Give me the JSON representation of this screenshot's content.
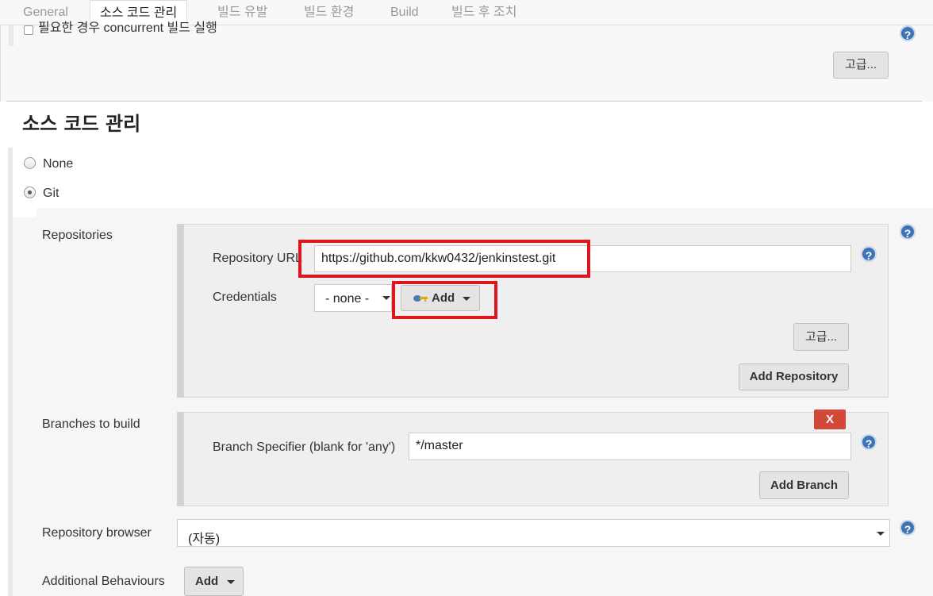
{
  "tabs": [
    "General",
    "소스 코드 관리",
    "빌드 유발",
    "빌드 환경",
    "Build",
    "빌드 후 조치"
  ],
  "top": {
    "concurrent_label": "필요한 경우 concurrent 빌드 실행",
    "advanced_label": "고급..."
  },
  "scm": {
    "title": "소스 코드 관리",
    "option_none": "None",
    "option_git": "Git",
    "repositories_label": "Repositories",
    "repo_url_label": "Repository URL",
    "repo_url_value": "https://github.com/kkw0432/jenkinstest.git",
    "credentials_label": "Credentials",
    "credentials_value": "- none -",
    "add_label": "Add",
    "advanced_label": "고급...",
    "add_repository_label": "Add Repository",
    "branches_label": "Branches to build",
    "delete_label": "X",
    "branch_spec_label": "Branch Specifier (blank for 'any')",
    "branch_spec_value": "*/master",
    "add_branch_label": "Add Branch",
    "repo_browser_label": "Repository browser",
    "repo_browser_value": "(자동)",
    "additional_label": "Additional Behaviours",
    "additional_add_label": "Add"
  },
  "help_glyph": "?",
  "colors": {
    "highlight": "#e0141e",
    "help": "#3e74b3",
    "danger": "#d24939"
  }
}
